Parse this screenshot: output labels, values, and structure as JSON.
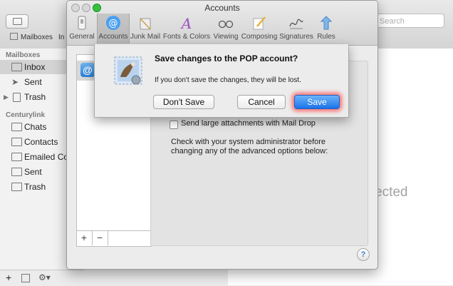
{
  "mail_window": {
    "favorites": [
      "Mailboxes",
      "In"
    ],
    "search_placeholder": "Search",
    "sidebar": {
      "section1": "Mailboxes",
      "mailboxes": [
        "Inbox",
        "Sent",
        "Trash"
      ],
      "section2": "Centurylink",
      "folders": [
        "Chats",
        "Contacts",
        "Emailed Co",
        "Sent",
        "Trash"
      ]
    },
    "bottom_bar": {
      "add": "+",
      "gear": "⚙▾"
    },
    "no_selection_text": "ected"
  },
  "preferences": {
    "title": "Accounts",
    "toolbar": [
      {
        "label": "General",
        "icon": "switch-icon"
      },
      {
        "label": "Accounts",
        "icon": "at-icon",
        "selected": true
      },
      {
        "label": "Junk Mail",
        "icon": "trash-icon"
      },
      {
        "label": "Fonts & Colors",
        "icon": "font-icon"
      },
      {
        "label": "Viewing",
        "icon": "glasses-icon"
      },
      {
        "label": "Composing",
        "icon": "pencil-icon"
      },
      {
        "label": "Signatures",
        "icon": "signature-icon"
      },
      {
        "label": "Rules",
        "icon": "rules-icon"
      }
    ],
    "account_icon_glyph": "@",
    "add_label": "+",
    "remove_label": "−",
    "mail_drop_label": "Send large attachments with Mail Drop",
    "advanced_text": "Check with your system administrator before changing any of the advanced options below:",
    "help_label": "?"
  },
  "dialog": {
    "title": "Save changes to the POP account?",
    "message": "If you don't save the changes, they will be lost.",
    "buttons": {
      "dont_save": "Don't Save",
      "cancel": "Cancel",
      "save": "Save"
    },
    "save_highlight_color": "#ff4646"
  }
}
